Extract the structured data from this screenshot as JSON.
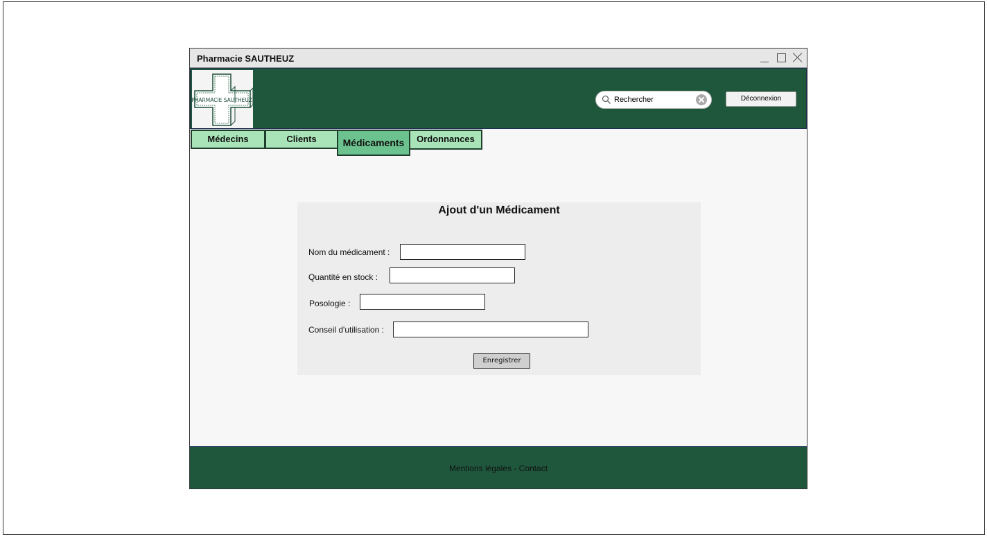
{
  "window": {
    "title": "Pharmacie SAUTHEUZ"
  },
  "header": {
    "logo_text": "PHARMACIE SAUTHEUZ",
    "search_placeholder": "Rechercher",
    "logout_label": "Déconnexion"
  },
  "tabs": [
    {
      "label": "Médecins",
      "active": false
    },
    {
      "label": "Clients",
      "active": false
    },
    {
      "label": "Médicaments",
      "active": true
    },
    {
      "label": "Ordonnances",
      "active": false
    }
  ],
  "form": {
    "title": "Ajout d'un Médicament",
    "fields": [
      {
        "label": "Nom du médicament :",
        "value": ""
      },
      {
        "label": "Quantité en stock :",
        "value": ""
      },
      {
        "label": "Posologie :",
        "value": ""
      },
      {
        "label": "Conseil d'utilisation :",
        "value": ""
      }
    ],
    "submit_label": "Enregistrer"
  },
  "footer": {
    "text": "Mentions légales - Contact"
  },
  "colors": {
    "header_bg": "#1f573c",
    "tab_bg": "#a9e4b8",
    "tab_active_bg": "#6cc28e",
    "form_bg": "#ededed"
  }
}
